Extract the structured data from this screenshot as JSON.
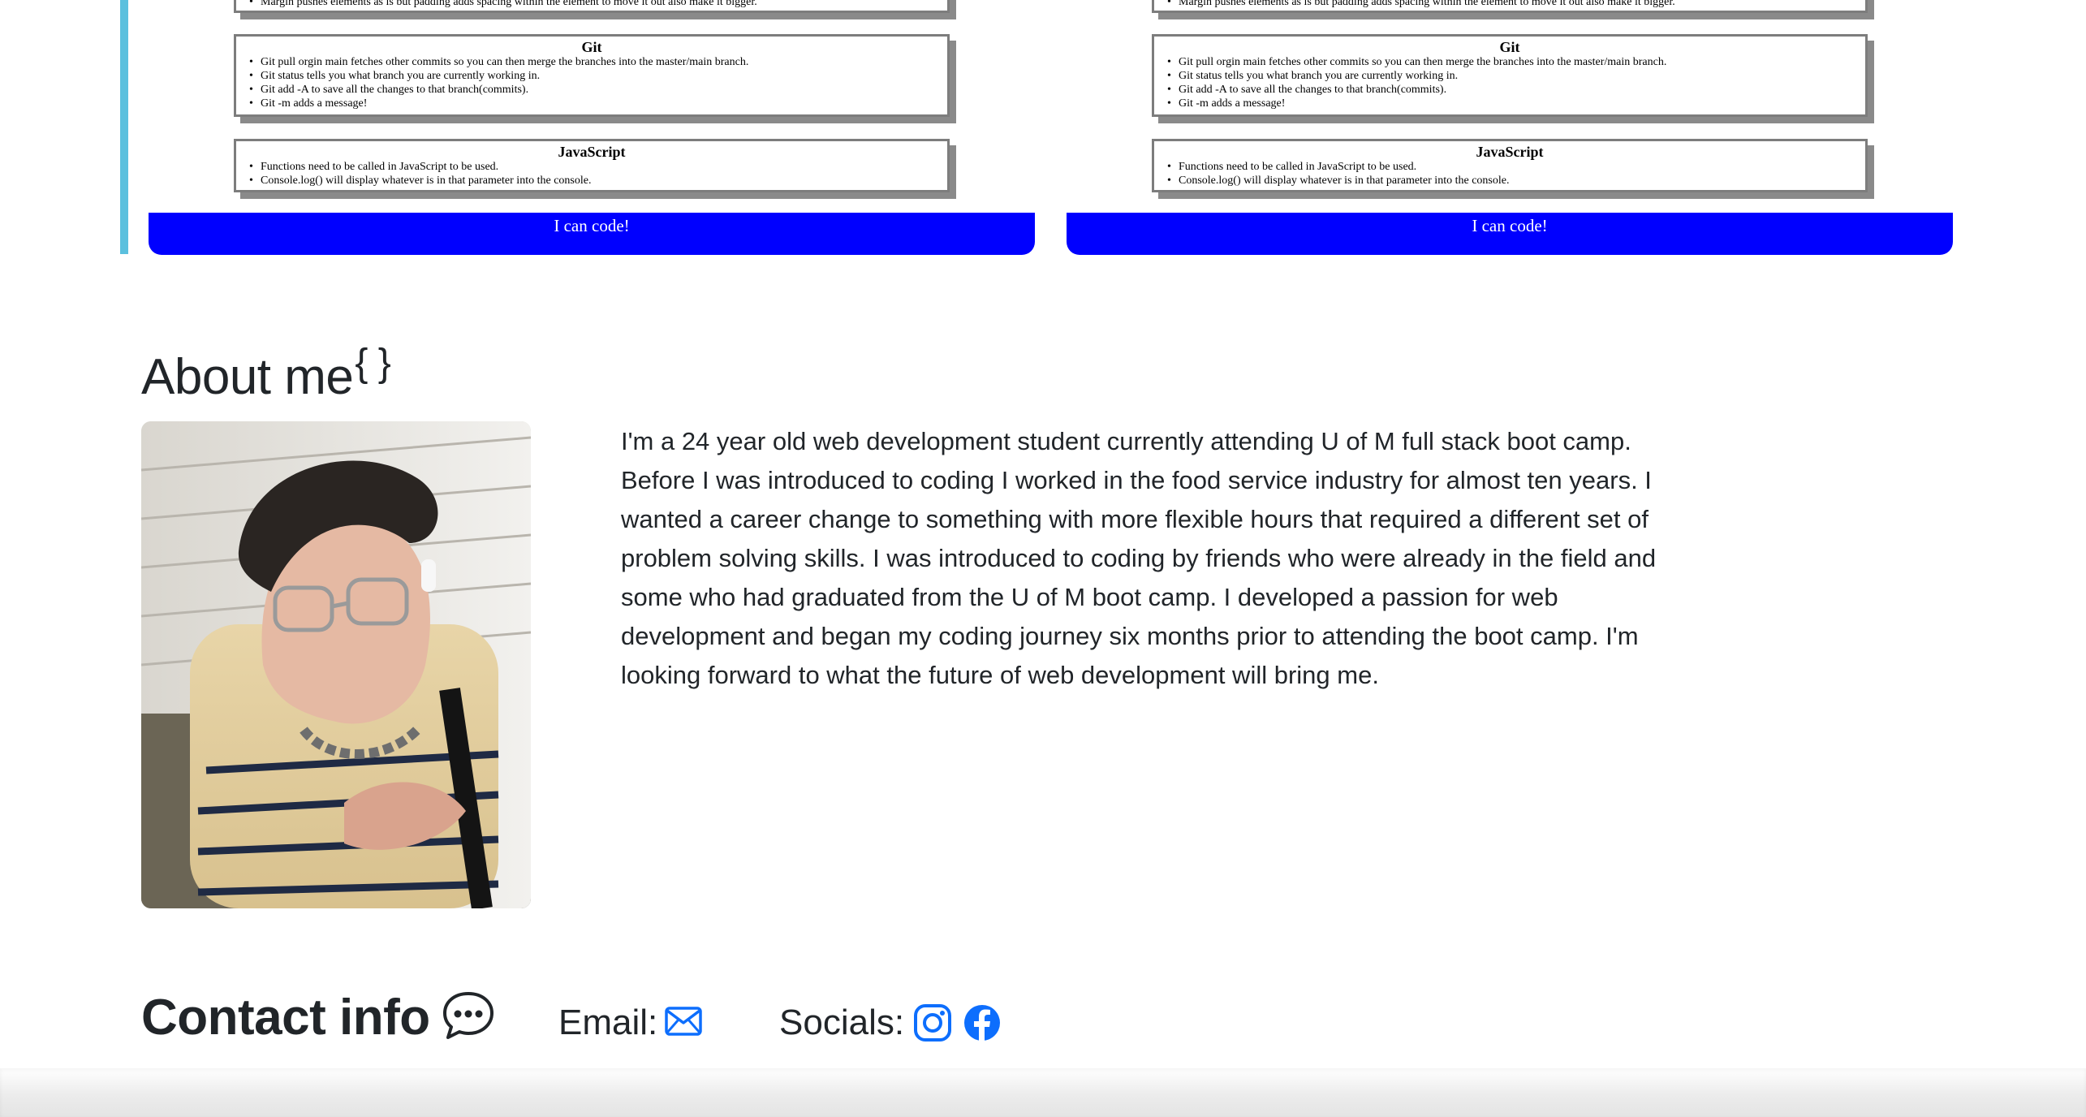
{
  "projects": [
    {
      "top_note_item": "Margin pushes elements as is but padding adds spacing within the element to move it out also make it bigger.",
      "git": {
        "title": "Git",
        "items": [
          "Git pull orgin main fetches other commits so you can then merge the branches into the master/main branch.",
          "Git status tells you what branch you are currently working in.",
          "Git add -A to save all the changes to that branch(commits).",
          "Git -m adds a message!"
        ]
      },
      "javascript": {
        "title": "JavaScript",
        "items": [
          "Functions need to be called in JavaScript to be used.",
          "Console.log() will display whatever is in that parameter into the console."
        ]
      },
      "button_label": "I can code!"
    },
    {
      "top_note_item": "Margin pushes elements as is but padding adds spacing within the element to move it out also make it bigger.",
      "git": {
        "title": "Git",
        "items": [
          "Git pull orgin main fetches other commits so you can then merge the branches into the master/main branch.",
          "Git status tells you what branch you are currently working in.",
          "Git add -A to save all the changes to that branch(commits).",
          "Git -m adds a message!"
        ]
      },
      "javascript": {
        "title": "JavaScript",
        "items": [
          "Functions need to be called in JavaScript to be used.",
          "Console.log() will display whatever is in that parameter into the console."
        ]
      },
      "button_label": "I can code!"
    }
  ],
  "about": {
    "title": "About me",
    "title_suffix": "{ }",
    "text": "I'm a 24 year old web development student currently attending U of M full stack boot camp. Before I was introduced to coding I worked in the food service industry for almost ten years. I wanted a career change to something with more flexible hours that required a different set of problem solving skills. I was introduced to coding by friends who were already in the field and some who had graduated from the U of M boot camp. I developed a passion for web development and began my coding journey six months prior to attending the boot camp. I'm looking forward to what the future of web development will bring me."
  },
  "contact": {
    "title": "Contact info",
    "email_label": "Email:",
    "socials_label": "Socials:",
    "icons": [
      "chat-dots-icon",
      "envelope-icon",
      "instagram-icon",
      "facebook-icon"
    ]
  },
  "colors": {
    "accent_stripe": "#5bc0de",
    "button_blue": "#0000ff",
    "icon_blue": "#0d6efd",
    "text": "#212529"
  }
}
